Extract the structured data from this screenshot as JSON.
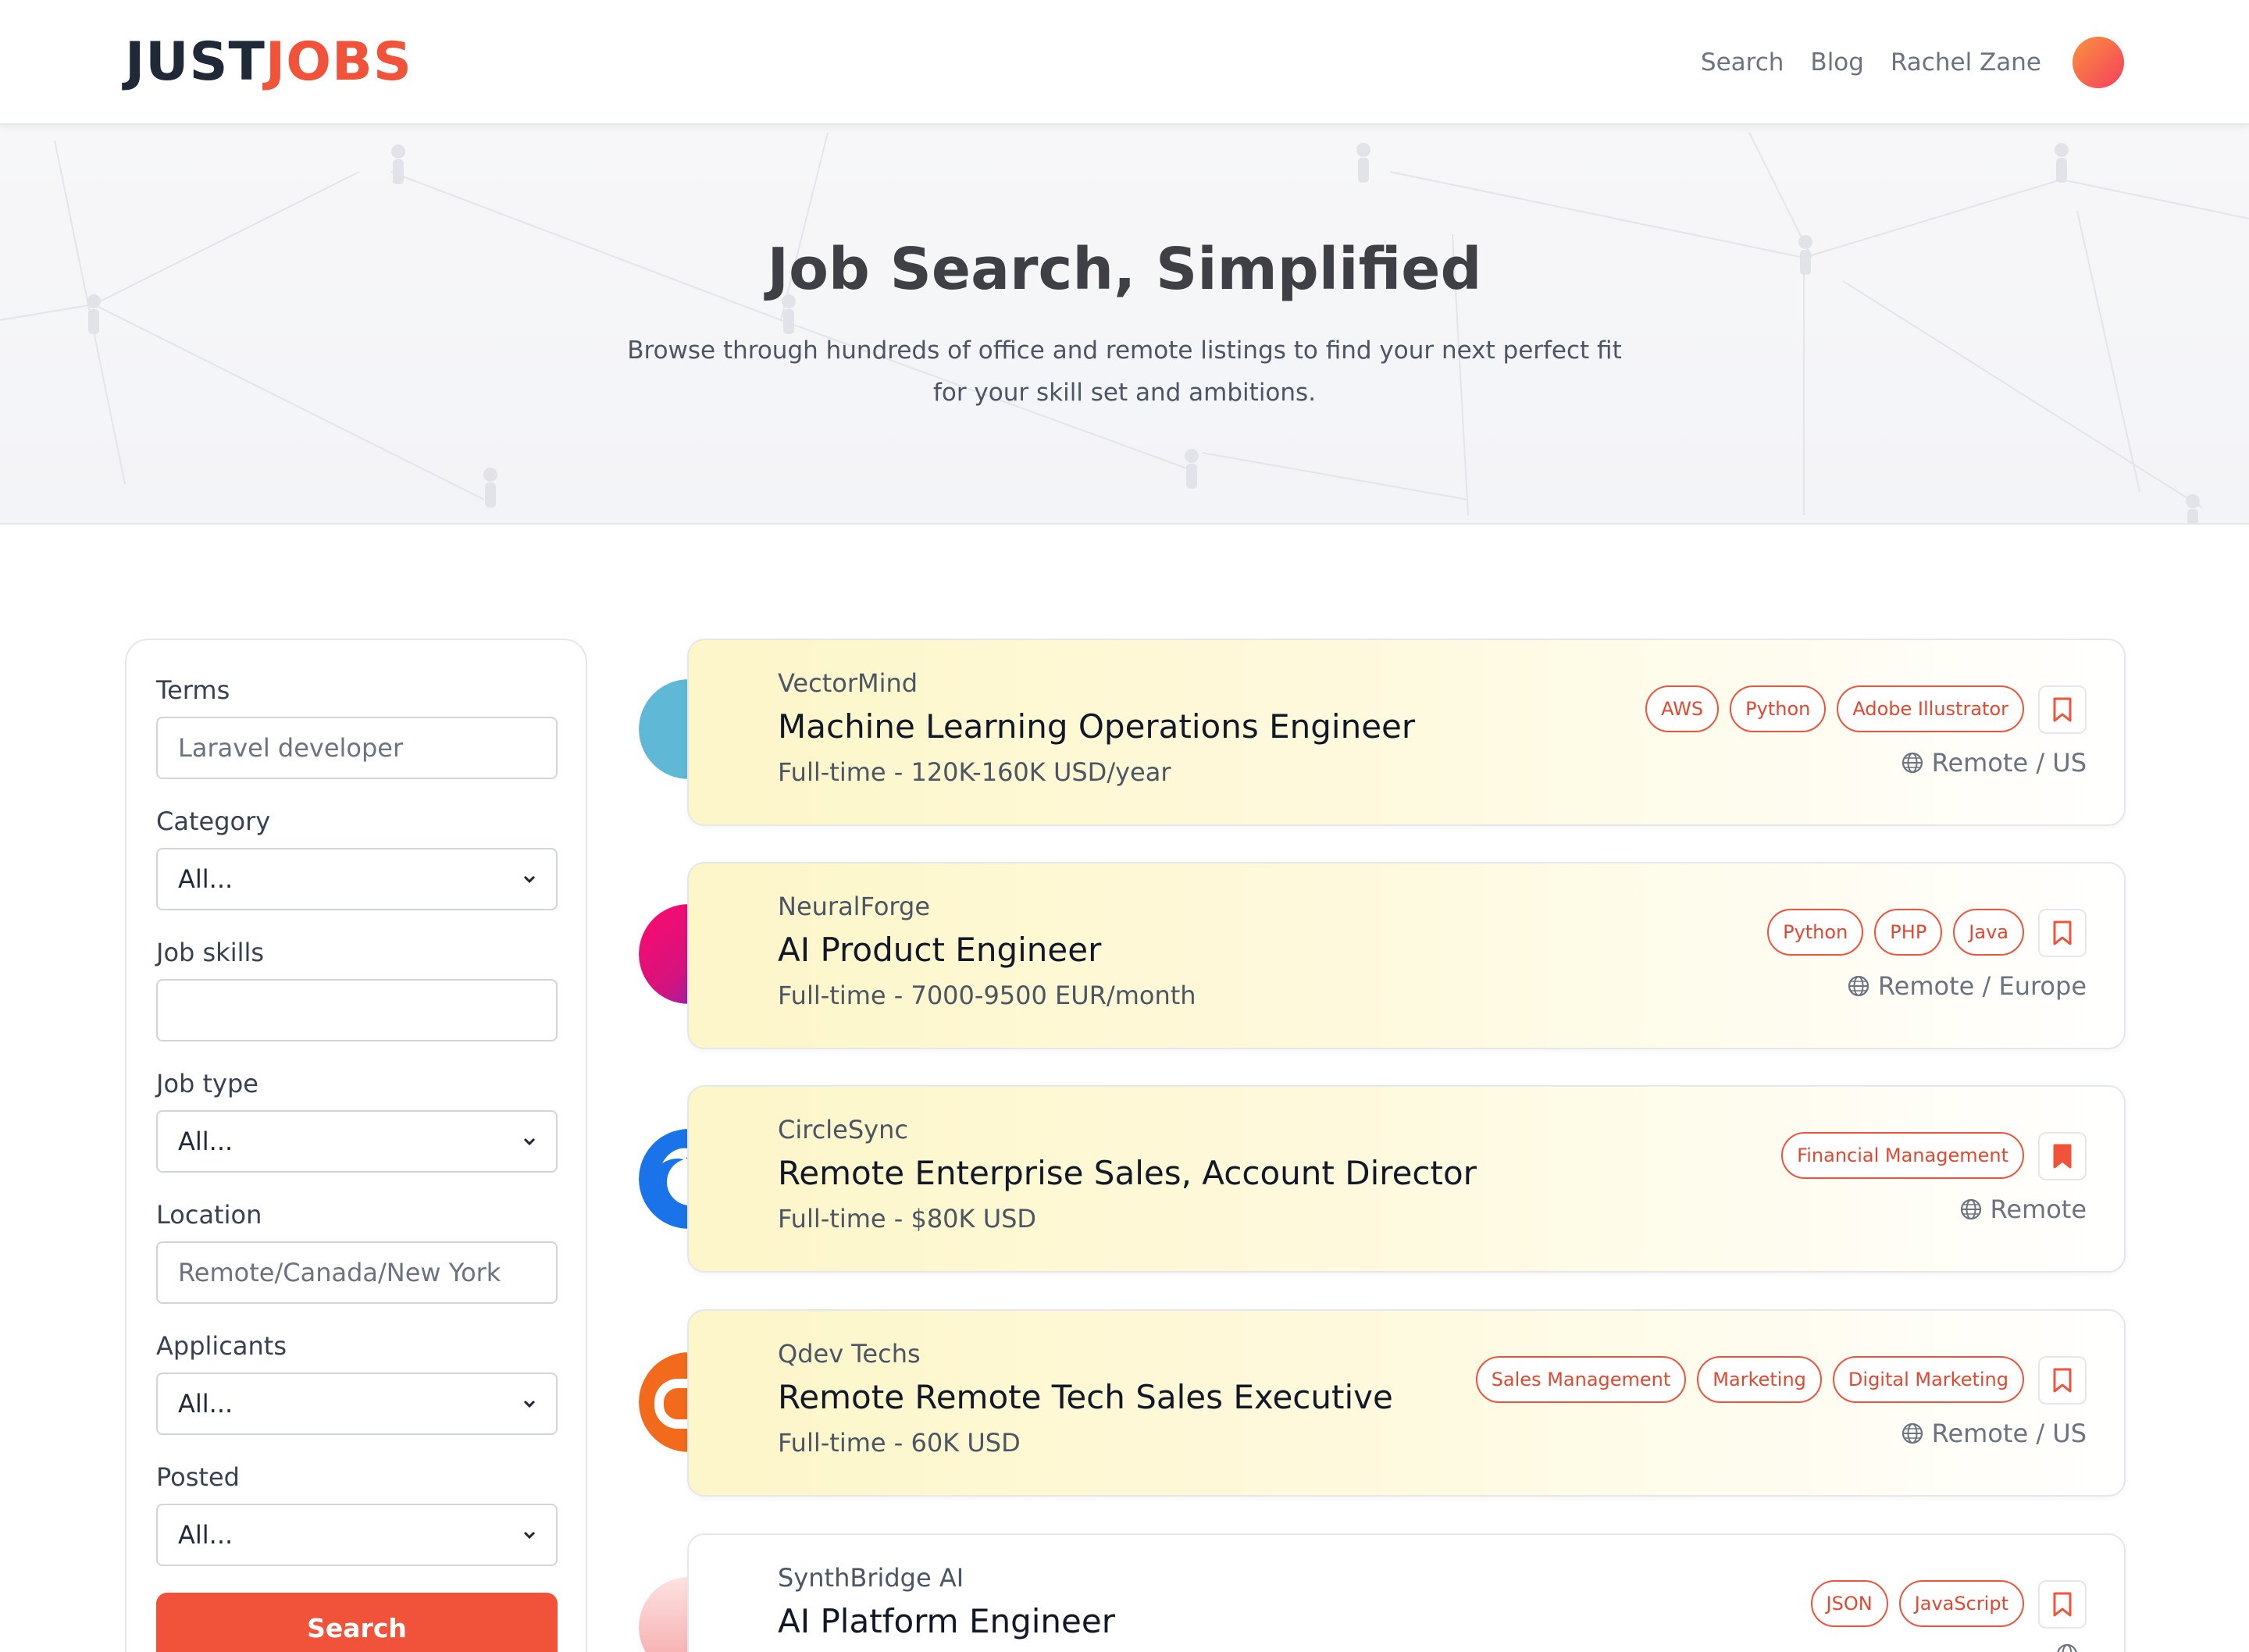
{
  "header": {
    "logo_just": "JUST",
    "logo_jobs": "JOBS",
    "nav": [
      "Search",
      "Blog",
      "Rachel Zane"
    ]
  },
  "hero": {
    "title": "Job Search, Simplified",
    "subtitle": "Browse through hundreds of office and remote listings to find your next perfect fit for your skill set and ambitions."
  },
  "filters": {
    "terms": {
      "label": "Terms",
      "placeholder": "Laravel developer"
    },
    "category": {
      "label": "Category",
      "value": "All..."
    },
    "job_skills": {
      "label": "Job skills",
      "value": ""
    },
    "job_type": {
      "label": "Job type",
      "value": "All..."
    },
    "location": {
      "label": "Location",
      "placeholder": "Remote/Canada/New York"
    },
    "applicants": {
      "label": "Applicants",
      "value": "All..."
    },
    "posted": {
      "label": "Posted",
      "value": "All..."
    },
    "search_label": "Search"
  },
  "jobs": [
    {
      "company": "VectorMind",
      "title": "Machine Learning Operations Engineer",
      "meta": "Full-time - 120K-160K USD/year",
      "tags": [
        "AWS",
        "Python",
        "Adobe Illustrator"
      ],
      "location": "Remote / US",
      "bookmarked": false,
      "logo_color": "#5eb8d6"
    },
    {
      "company": "NeuralForge",
      "title": "AI Product Engineer",
      "meta": "Full-time - 7000-9500 EUR/month",
      "tags": [
        "Python",
        "PHP",
        "Java"
      ],
      "location": "Remote / Europe",
      "bookmarked": false,
      "logo_color": "#e8127c"
    },
    {
      "company": "CircleSync",
      "title": "Remote Enterprise Sales, Account Director",
      "meta": "Full-time - $80K USD",
      "tags": [
        "Financial Management"
      ],
      "location": "Remote",
      "bookmarked": true,
      "logo_color": "#1a73e8"
    },
    {
      "company": "Qdev Techs",
      "title": "Remote Remote Tech Sales Executive",
      "meta": "Full-time - 60K USD",
      "tags": [
        "Sales Management",
        "Marketing",
        "Digital Marketing"
      ],
      "location": "Remote / US",
      "bookmarked": false,
      "logo_color": "#f26a1b"
    },
    {
      "company": "SynthBridge AI",
      "title": "AI Platform Engineer",
      "meta": "",
      "tags": [
        "JSON",
        "JavaScript"
      ],
      "location": "",
      "bookmarked": false,
      "logo_color": "#f6b3b3"
    }
  ],
  "colors": {
    "accent": "#f0533a",
    "card_highlight": "#fdf6c9"
  }
}
